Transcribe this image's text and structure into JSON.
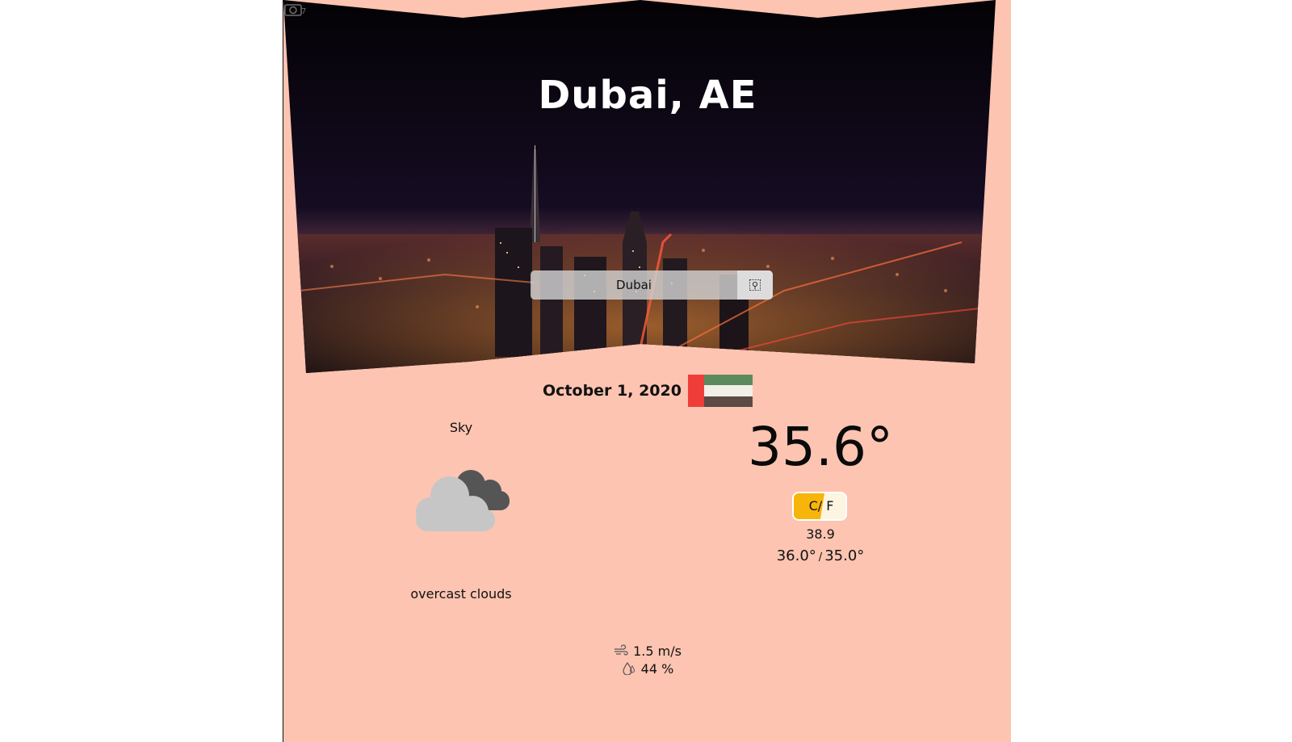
{
  "header": {
    "city_title": "Dubai, AE"
  },
  "search": {
    "value": "Dubai",
    "button_icon": "search-icon"
  },
  "date": "October 1, 2020",
  "flag": {
    "name": "uae-flag",
    "colors": {
      "red": "#ef3e3a",
      "green": "#5d8a5d",
      "white": "#f2efe9",
      "black": "#5b4a46"
    }
  },
  "sky": {
    "label": "Sky",
    "icon": "overcast-clouds-icon",
    "description": "overcast clouds"
  },
  "temperature": {
    "current": "35.6°",
    "unit_toggle": "C/ F",
    "feels_like": "38.9",
    "max": "36.0°",
    "separator": "/",
    "min": "35.0°"
  },
  "stats": {
    "wind": "1.5 m/s",
    "humidity": "44 %"
  },
  "colors": {
    "background": "#fcc4b1",
    "toggle_fill": "#f7b50a",
    "toggle_bg": "#fdf4e1"
  }
}
